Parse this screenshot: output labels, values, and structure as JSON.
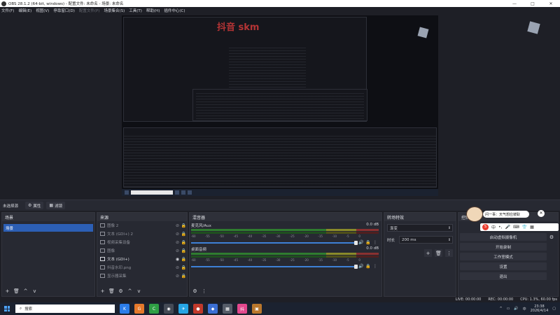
{
  "window": {
    "title": "OBS 28.1.2 (64-bit, windows) - 配置文件: 未命名 - 场景: 未命名",
    "controls": [
      "—",
      "□",
      "✕"
    ]
  },
  "menu": [
    {
      "label": "文件(F)",
      "dim": false
    },
    {
      "label": "编辑(E)",
      "dim": false
    },
    {
      "label": "视图(V)",
      "dim": false
    },
    {
      "label": "停靠窗口(D)",
      "dim": false
    },
    {
      "label": "配置文件(P)",
      "dim": true
    },
    {
      "label": "场景集合(S)",
      "dim": false
    },
    {
      "label": "工具(T)",
      "dim": false
    },
    {
      "label": "帮助(H)",
      "dim": false
    },
    {
      "label": "插件中心(C)",
      "dim": false
    }
  ],
  "preview": {
    "watermark": "抖音 skm"
  },
  "source_toolbar": {
    "no_source": "未选择源",
    "properties": "属性",
    "filters": "滤镜"
  },
  "scenes": {
    "title": "场景",
    "items": [
      "场景"
    ],
    "footer": [
      "+",
      "🗑",
      "^",
      "v"
    ]
  },
  "sources": {
    "title": "来源",
    "items": [
      {
        "label": "图像 2",
        "active": false,
        "locked": true
      },
      {
        "label": "文本 (GDI+) 2",
        "active": false,
        "locked": true
      },
      {
        "label": "视频采集设备",
        "active": false,
        "locked": true
      },
      {
        "label": "图像",
        "active": false,
        "locked": true
      },
      {
        "label": "文本 (GDI+)",
        "active": true,
        "locked": true
      },
      {
        "label": "抖音水印.png",
        "active": false,
        "locked": true
      },
      {
        "label": "显示器采集",
        "active": false,
        "locked": true
      }
    ],
    "footer": [
      "+",
      "🗑",
      "⚙",
      "^",
      "v"
    ]
  },
  "mixer": {
    "title": "混音器",
    "channels": [
      {
        "name": "麦克风/Aux",
        "db": "0.0 dB"
      },
      {
        "name": "桌面音频",
        "db": "0.0 dB"
      }
    ],
    "scale": [
      "-60",
      "-55",
      "-50",
      "-45",
      "-40",
      "-35",
      "-30",
      "-25",
      "-20",
      "-15",
      "-10",
      "-5",
      "0"
    ]
  },
  "transitions": {
    "title": "转场特效",
    "selected": "渐变",
    "duration_label": "时长",
    "duration_value": "200 ms"
  },
  "controls": {
    "title": "控制",
    "buttons": [
      "启动虚拟摄像机",
      "开始录制",
      "工作室模式",
      "设置",
      "退出"
    ]
  },
  "overlay": {
    "bubble": "问一事：天气想应彼耿"
  },
  "status": {
    "live": "LIVE: 00:00:00",
    "rec": "REC: 00:00:00",
    "cpu": "CPU: 1.3%, 60.00 fps"
  },
  "taskbar": {
    "search_placeholder": "搜索",
    "time": "23:38",
    "date": "2026/4/14",
    "apps": [
      {
        "label": "K",
        "color": "#2b7de9"
      },
      {
        "label": "G",
        "color": "#e5792b"
      },
      {
        "label": "C",
        "color": "#2f9e44"
      },
      {
        "label": "◉",
        "color": "#444a55"
      },
      {
        "label": "✈",
        "color": "#26a5e4"
      },
      {
        "label": "●",
        "color": "#c0392b"
      },
      {
        "label": "◆",
        "color": "#3b6fd4"
      },
      {
        "label": "▦",
        "color": "#555c68"
      },
      {
        "label": "抖",
        "color": "#e3488d"
      },
      {
        "label": "▣",
        "color": "#b9772c"
      }
    ]
  }
}
